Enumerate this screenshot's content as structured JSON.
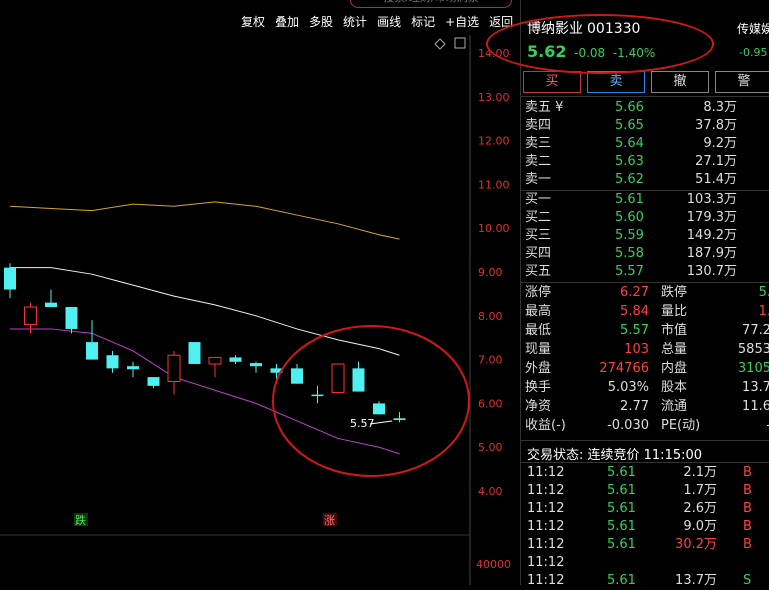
{
  "search": {
    "text": "搜索/理财/市场洞察"
  },
  "toolbar": [
    "复权",
    "叠加",
    "多股",
    "统计",
    "画线",
    "标记",
    "+自选",
    "返回"
  ],
  "axis": {
    "ticks": [
      "14.00",
      "13.00",
      "12.00",
      "11.00",
      "10.00",
      "9.00",
      "8.00",
      "7.00",
      "6.00",
      "5.00",
      "4.00"
    ],
    "volume_label": "40000"
  },
  "chart_data": {
    "type": "candlestick",
    "ylim": [
      3.8,
      14.2
    ],
    "ylabel_ticks": [
      14,
      13,
      12,
      11,
      10,
      9,
      8,
      7,
      6,
      5,
      4
    ],
    "candles": [
      {
        "open": 8.6,
        "close": 9.1,
        "high": 9.2,
        "low": 8.4,
        "color": "cyan"
      },
      {
        "open": 7.8,
        "close": 8.2,
        "high": 8.3,
        "low": 7.6,
        "color": "red"
      },
      {
        "open": 8.3,
        "close": 8.2,
        "high": 8.6,
        "low": 8.2,
        "color": "cyan"
      },
      {
        "open": 8.2,
        "close": 7.7,
        "high": 8.2,
        "low": 7.6,
        "color": "cyan"
      },
      {
        "open": 7.4,
        "close": 7.0,
        "high": 7.9,
        "low": 7.0,
        "color": "cyan"
      },
      {
        "open": 7.1,
        "close": 6.8,
        "high": 7.2,
        "low": 6.7,
        "color": "cyan"
      },
      {
        "open": 6.85,
        "close": 6.78,
        "high": 6.95,
        "low": 6.6,
        "color": "cyan"
      },
      {
        "open": 6.6,
        "close": 6.4,
        "high": 6.6,
        "low": 6.35,
        "color": "cyan"
      },
      {
        "open": 6.5,
        "close": 7.1,
        "high": 7.2,
        "low": 6.2,
        "color": "red"
      },
      {
        "open": 7.4,
        "close": 6.9,
        "high": 7.4,
        "low": 6.9,
        "color": "cyan"
      },
      {
        "open": 6.9,
        "close": 7.05,
        "high": 7.05,
        "low": 6.6,
        "color": "red"
      },
      {
        "open": 7.05,
        "close": 6.95,
        "high": 7.1,
        "low": 6.9,
        "color": "cyan"
      },
      {
        "open": 6.92,
        "close": 6.85,
        "high": 6.95,
        "low": 6.7,
        "color": "cyan"
      },
      {
        "open": 6.8,
        "close": 6.7,
        "high": 6.9,
        "low": 6.5,
        "color": "cyan"
      },
      {
        "open": 6.8,
        "close": 6.45,
        "high": 6.9,
        "low": 6.45,
        "color": "cyan"
      },
      {
        "open": 6.2,
        "close": 6.2,
        "high": 6.4,
        "low": 6.0,
        "color": "cyan"
      },
      {
        "open": 6.25,
        "close": 6.9,
        "high": 6.9,
        "low": 6.25,
        "color": "red"
      },
      {
        "open": 6.8,
        "close": 6.27,
        "high": 6.95,
        "low": 6.27,
        "color": "cyan"
      },
      {
        "open": 6.0,
        "close": 5.75,
        "high": 6.05,
        "low": 5.75,
        "color": "cyan"
      },
      {
        "open": 5.66,
        "close": 5.62,
        "high": 5.8,
        "low": 5.57,
        "color": "cyan"
      }
    ],
    "ma_lines": [
      {
        "color": "#d4a72c",
        "points": [
          [
            0,
            10.5
          ],
          [
            2,
            10.45
          ],
          [
            4,
            10.4
          ],
          [
            6,
            10.55
          ],
          [
            8,
            10.5
          ],
          [
            10,
            10.6
          ],
          [
            12,
            10.5
          ],
          [
            14,
            10.3
          ],
          [
            16,
            10.1
          ],
          [
            18,
            9.85
          ],
          [
            19,
            9.75
          ]
        ]
      },
      {
        "color": "#f0f0f0",
        "points": [
          [
            0,
            9.1
          ],
          [
            2,
            9.1
          ],
          [
            4,
            8.95
          ],
          [
            6,
            8.7
          ],
          [
            8,
            8.45
          ],
          [
            10,
            8.25
          ],
          [
            12,
            8.0
          ],
          [
            14,
            7.7
          ],
          [
            16,
            7.45
          ],
          [
            18,
            7.25
          ],
          [
            19,
            7.1
          ]
        ]
      },
      {
        "color": "#c040d0",
        "points": [
          [
            0,
            7.7
          ],
          [
            2,
            7.7
          ],
          [
            4,
            7.6
          ],
          [
            6,
            7.2
          ],
          [
            8,
            6.6
          ],
          [
            10,
            6.3
          ],
          [
            12,
            6.0
          ],
          [
            14,
            5.6
          ],
          [
            16,
            5.2
          ],
          [
            18,
            5.0
          ],
          [
            19,
            4.85
          ]
        ]
      }
    ],
    "annotations": {
      "low_label": "5.57",
      "fall_marker": "跌",
      "rise_marker": "涨"
    }
  },
  "panel": {
    "name": "博纳影业",
    "code": "001330",
    "price": "5.62",
    "change": "-0.08",
    "pct": "-1.40%",
    "side_name": "传媒娱",
    "side_chg": "-0.95",
    "buttons": {
      "buy": "买",
      "sell": "卖",
      "cancel": "撤",
      "warn": "警"
    },
    "asks": [
      {
        "label": "卖五 ¥",
        "price": "5.66",
        "vol": "8.3万"
      },
      {
        "label": "卖四",
        "price": "5.65",
        "vol": "37.8万"
      },
      {
        "label": "卖三",
        "price": "5.64",
        "vol": "9.2万"
      },
      {
        "label": "卖二",
        "price": "5.63",
        "vol": "27.1万"
      },
      {
        "label": "卖一",
        "price": "5.62",
        "vol": "51.4万"
      }
    ],
    "bids": [
      {
        "label": "买一",
        "price": "5.61",
        "vol": "103.3万"
      },
      {
        "label": "买二",
        "price": "5.60",
        "vol": "179.3万"
      },
      {
        "label": "买三",
        "price": "5.59",
        "vol": "149.2万"
      },
      {
        "label": "买四",
        "price": "5.58",
        "vol": "187.9万"
      },
      {
        "label": "买五",
        "price": "5.57",
        "vol": "130.7万"
      }
    ],
    "stats": [
      {
        "l1": "涨停",
        "v1": "6.27",
        "c1": "red",
        "l2": "跌停",
        "v2": "5.",
        "c2": "green"
      },
      {
        "l1": "最高",
        "v1": "5.84",
        "c1": "red",
        "l2": "量比",
        "v2": "1.",
        "c2": "red"
      },
      {
        "l1": "最低",
        "v1": "5.57",
        "c1": "green",
        "l2": "市值",
        "v2": "77.2",
        "c2": "white"
      },
      {
        "l1": "现量",
        "v1": "103",
        "c1": "red",
        "l2": "总量",
        "v2": "5853",
        "c2": "white"
      },
      {
        "l1": "外盘",
        "v1": "274766",
        "c1": "red",
        "l2": "内盘",
        "v2": "3105",
        "c2": "green"
      },
      {
        "l1": "换手",
        "v1": "5.03%",
        "c1": "white",
        "l2": "股本",
        "v2": "13.7",
        "c2": "white"
      },
      {
        "l1": "净资",
        "v1": "2.77",
        "c1": "white",
        "l2": "流通",
        "v2": "11.6",
        "c2": "white"
      },
      {
        "l1": "收益(-)",
        "v1": "-0.030",
        "c1": "white",
        "l2": "PE(动)",
        "v2": "-",
        "c2": "white"
      }
    ],
    "status": "交易状态: 连续竞价 11:15:00",
    "ticks": [
      {
        "time": "11:12",
        "price": "5.61",
        "vol": "2.1万",
        "bs": "B"
      },
      {
        "time": "11:12",
        "price": "5.61",
        "vol": "1.7万",
        "bs": "B"
      },
      {
        "time": "11:12",
        "price": "5.61",
        "vol": "2.6万",
        "bs": "B"
      },
      {
        "time": "11:12",
        "price": "5.61",
        "vol": "9.0万",
        "bs": "B"
      },
      {
        "time": "11:12",
        "price": "5.61",
        "vol": "30.2万",
        "bs": "B"
      },
      {
        "time": "11:12",
        "price": "",
        "vol": "",
        "bs": ""
      },
      {
        "time": "11:12",
        "price": "5.61",
        "vol": "13.7万",
        "bs": "S"
      }
    ]
  }
}
